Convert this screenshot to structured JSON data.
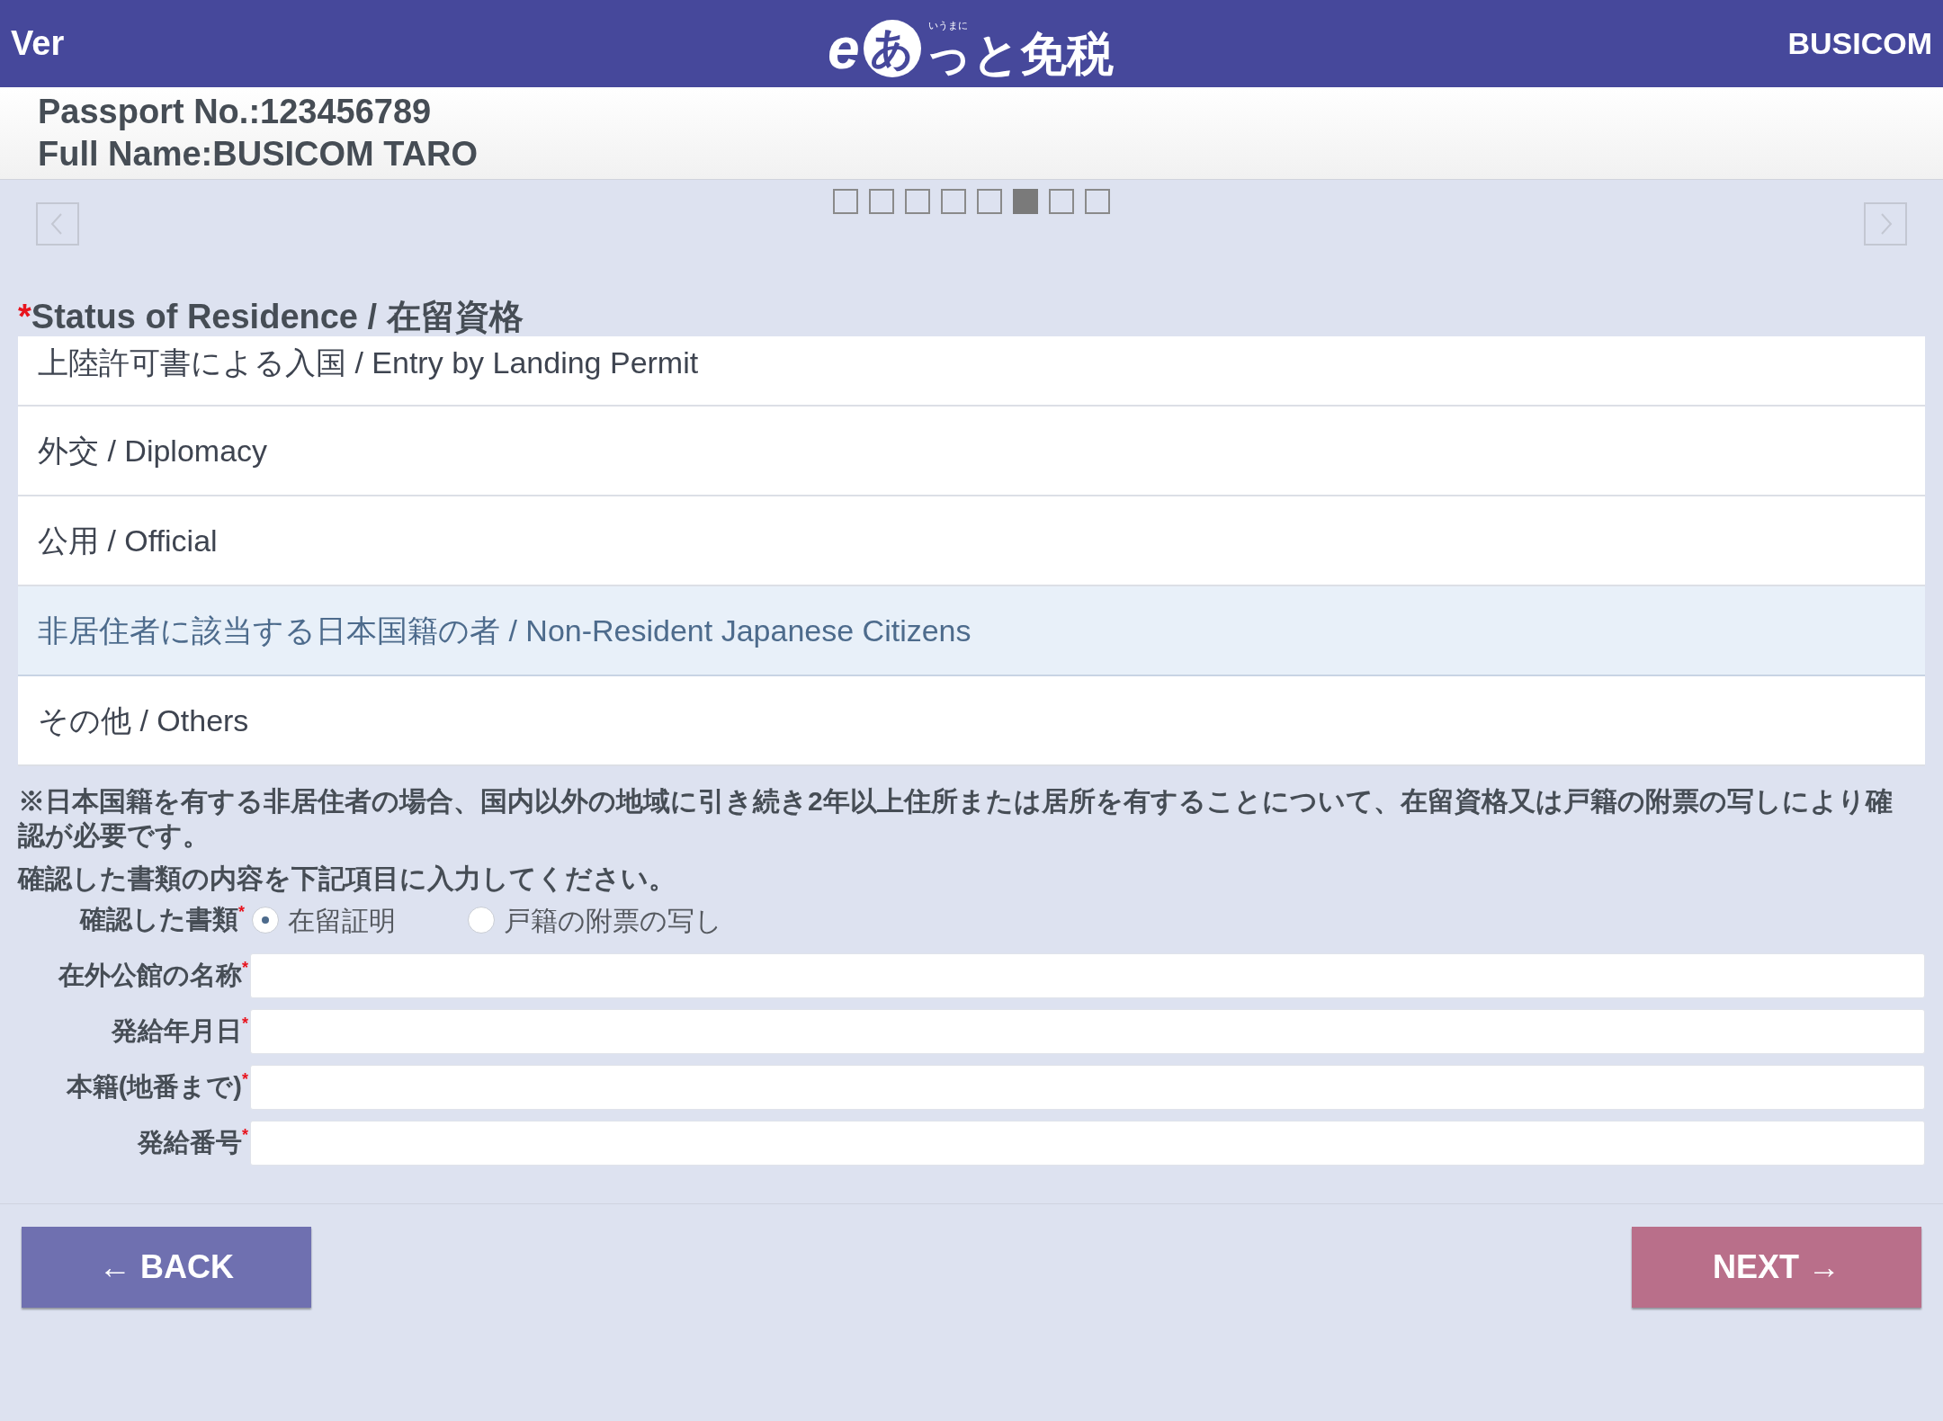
{
  "header": {
    "version": "Ver",
    "logo": {
      "e": "e",
      "a": "あ",
      "ruby": "いうまに",
      "rest": "っと免税"
    },
    "brand": "BUSICOM"
  },
  "traveler": [
    "Passport No.:123456789",
    "Full Name:BUSICOM TARO"
  ],
  "pager": [
    {
      "selected": false
    },
    {
      "selected": false
    },
    {
      "selected": false
    },
    {
      "selected": false
    },
    {
      "selected": false
    },
    {
      "selected": true
    },
    {
      "selected": false
    },
    {
      "selected": false
    }
  ],
  "status_of_residence": {
    "required_mark": "*",
    "title": "Status of Residence / 在留資格",
    "options": [
      {
        "label": "上陸許可書による入国 / Entry by Landing Permit",
        "selected": false
      },
      {
        "label": "外交 / Diplomacy",
        "selected": false
      },
      {
        "label": "公用 / Official",
        "selected": false
      },
      {
        "label": "非居住者に該当する日本国籍の者 / Non-Resident Japanese Citizens",
        "selected": true
      },
      {
        "label": "その他 / Others",
        "selected": false
      }
    ]
  },
  "note": "※日本国籍を有する非居住者の場合、国内以外の地域に引き続き2年以上住所または居所を有することについて、在留資格又は戸籍の附票の写しにより確認が必要です。",
  "instruction": "確認した書類の内容を下記項目に入力してください。",
  "document_type": {
    "label": "確認した書類",
    "required_mark": "*",
    "options": [
      {
        "label": "在留証明",
        "selected": true
      },
      {
        "label": "戸籍の附票の写し",
        "selected": false
      }
    ]
  },
  "fields": [
    {
      "label": "在外公館の名称",
      "required_mark": "*"
    },
    {
      "label": "発給年月日",
      "required_mark": "*"
    },
    {
      "label": "本籍(地番まで)",
      "required_mark": "*"
    },
    {
      "label": "発給番号",
      "required_mark": "*"
    }
  ],
  "buttons": {
    "back": "← BACK",
    "next": "NEXT →"
  }
}
